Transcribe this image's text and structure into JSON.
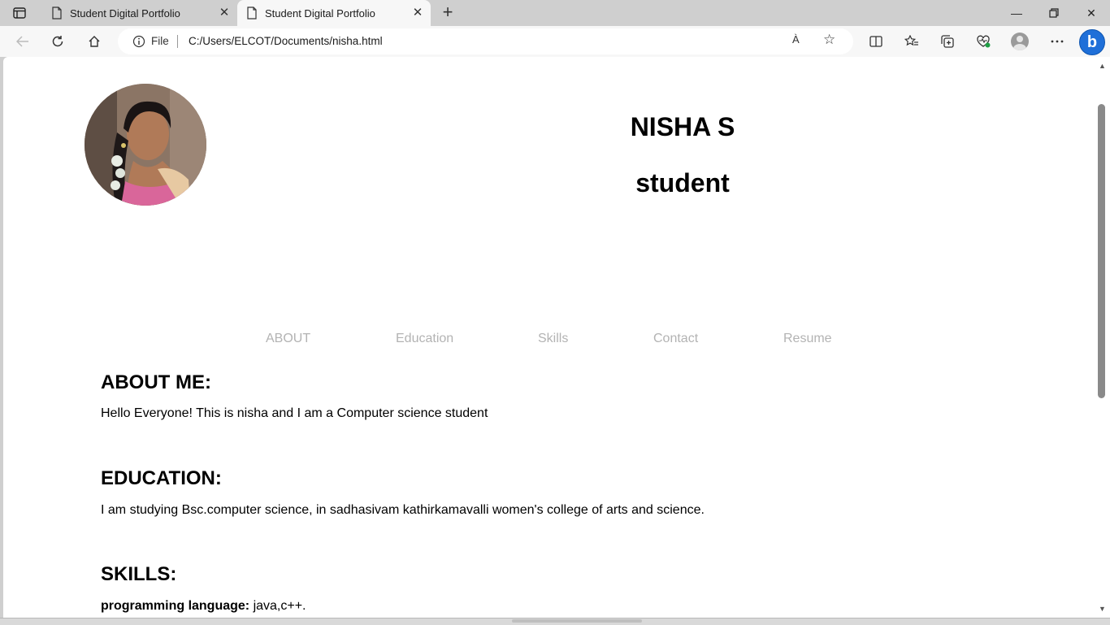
{
  "browser": {
    "tabs": [
      {
        "label": "Student Digital Portfolio",
        "active": false
      },
      {
        "label": "Student Digital Portfolio",
        "active": true
      }
    ],
    "address": {
      "info_label": "File",
      "url": "C:/Users/ELCOT/Documents/nisha.html"
    },
    "read_aloud": "À"
  },
  "profile": {
    "name": "NISHA S",
    "role": "student"
  },
  "nav": [
    "ABOUT",
    "Education",
    "Skills",
    "Contact",
    "Resume"
  ],
  "about": {
    "heading": "ABOUT ME:",
    "text": "Hello Everyone! This is nisha and I am a Computer science student"
  },
  "education": {
    "heading": "EDUCATION:",
    "text": "I am studying Bsc.computer science, in sadhasivam kathirkamavalli women's college of arts and science."
  },
  "skills": {
    "heading": "SKILLS:",
    "label": "programming language:",
    "value": " java,c++."
  }
}
